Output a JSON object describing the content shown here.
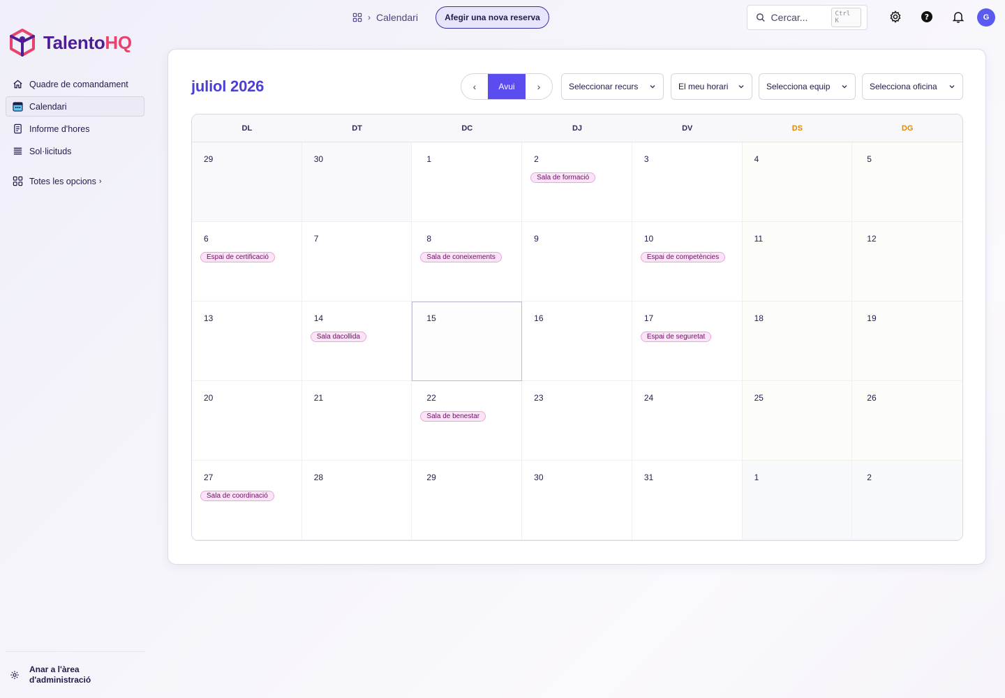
{
  "brand": {
    "name_primary": "Talento",
    "name_accent": "HQ",
    "color_primary": "#4c1d95",
    "color_accent": "#e8436e"
  },
  "sidebar": {
    "items": [
      {
        "label": "Quadre de comandament",
        "icon": "home-icon"
      },
      {
        "label": "Calendari",
        "icon": "calendar-icon",
        "active": true
      },
      {
        "label": "Informe d'hores",
        "icon": "report-icon"
      },
      {
        "label": "Sol·licituds",
        "icon": "list-icon"
      }
    ],
    "all_options": "Totes les opcions",
    "admin_link": "Anar a l'àrea d'administració"
  },
  "topbar": {
    "breadcrumb": "Calendari",
    "new_booking": "Afegir una nova reserva",
    "search_placeholder": "Cercar...",
    "search_shortcut": "Ctrl K",
    "avatar_initial": "G"
  },
  "calendar": {
    "month_title": "juliol 2026",
    "today_label": "Avui",
    "filters": {
      "resource": "Seleccionar recurs",
      "schedule": "El meu horari",
      "team": "Selecciona equip",
      "office": "Selecciona oficina"
    },
    "weekdays": [
      "DL",
      "DT",
      "DC",
      "DJ",
      "DV",
      "DS",
      "DG"
    ],
    "accent_color": "#5b4cf0",
    "weekend_color": "#e08a00",
    "weeks": [
      [
        {
          "d": "29",
          "other": true
        },
        {
          "d": "30",
          "other": true
        },
        {
          "d": "1"
        },
        {
          "d": "2",
          "event": "Sala de formació"
        },
        {
          "d": "3"
        },
        {
          "d": "4"
        },
        {
          "d": "5"
        }
      ],
      [
        {
          "d": "6",
          "event": "Espai de certificació"
        },
        {
          "d": "7"
        },
        {
          "d": "8",
          "event": "Sala de coneixements"
        },
        {
          "d": "9"
        },
        {
          "d": "10",
          "event": "Espai de competències"
        },
        {
          "d": "11"
        },
        {
          "d": "12"
        }
      ],
      [
        {
          "d": "13"
        },
        {
          "d": "14",
          "event": "Sala dacollida"
        },
        {
          "d": "15",
          "today": true
        },
        {
          "d": "16"
        },
        {
          "d": "17",
          "event": "Espai de seguretat"
        },
        {
          "d": "18"
        },
        {
          "d": "19"
        }
      ],
      [
        {
          "d": "20"
        },
        {
          "d": "21"
        },
        {
          "d": "22",
          "event": "Sala de benestar"
        },
        {
          "d": "23"
        },
        {
          "d": "24"
        },
        {
          "d": "25"
        },
        {
          "d": "26"
        }
      ],
      [
        {
          "d": "27",
          "event": "Sala de coordinació"
        },
        {
          "d": "28"
        },
        {
          "d": "29"
        },
        {
          "d": "30"
        },
        {
          "d": "31"
        },
        {
          "d": "1",
          "other": true
        },
        {
          "d": "2",
          "other": true
        }
      ]
    ]
  }
}
